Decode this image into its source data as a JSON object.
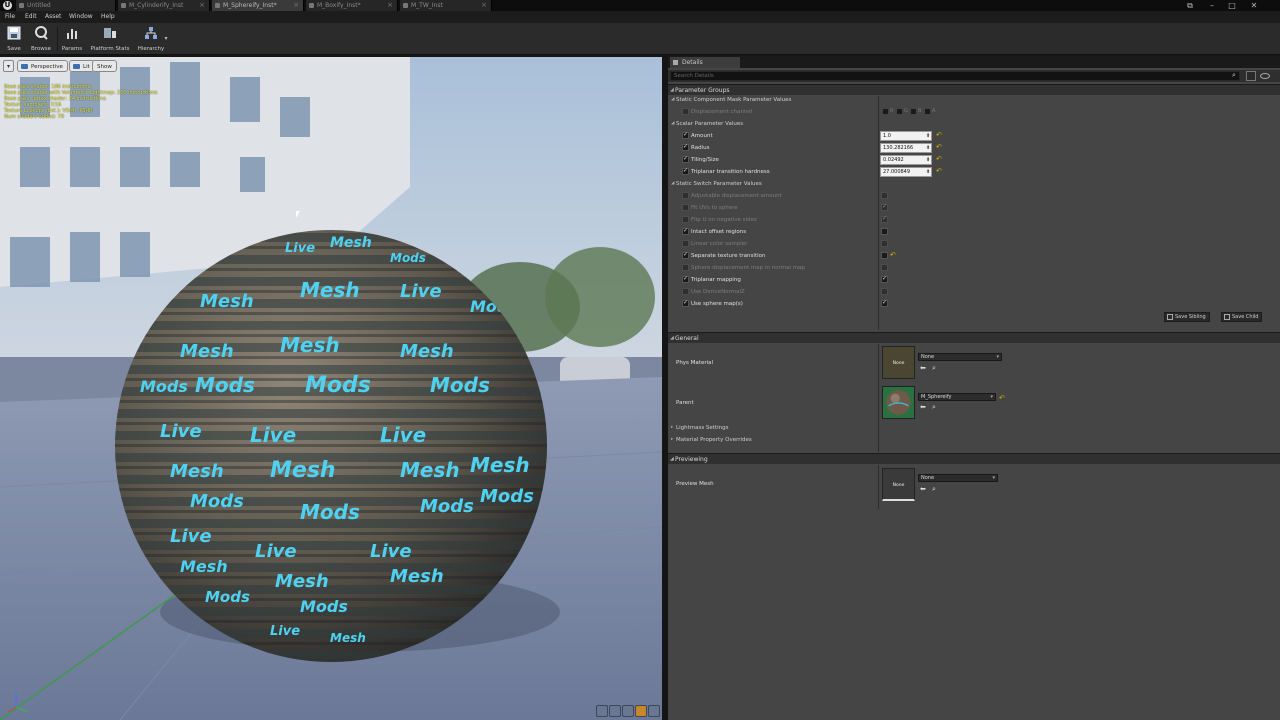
{
  "window": {
    "logo": "U",
    "tabs": [
      {
        "label": "Untitled",
        "active": false
      },
      {
        "label": "M_Cylinderify_Inst",
        "active": false
      },
      {
        "label": "M_Sphereify_Inst*",
        "active": true
      },
      {
        "label": "M_Boxify_Inst*",
        "active": false
      },
      {
        "label": "M_TW_Inst",
        "active": false
      }
    ],
    "controls": {
      "restore": "⧉",
      "minimize": "–",
      "maximize": "□",
      "close": "✕"
    }
  },
  "menu": [
    "File",
    "Edit",
    "Asset",
    "Window",
    "Help"
  ],
  "toolbar": {
    "save": "Save",
    "browse": "Browse",
    "params": "Params",
    "platform_stats": "Platform Stats",
    "hierarchy": "Hierarchy"
  },
  "viewport": {
    "dropdown": "▾",
    "perspective": "Perspective",
    "lit": "Lit",
    "show": "Show",
    "stats": [
      "Base pass shader: 186 instructions",
      "Base pass shader with Volumetric Lightmap: 256 instructions",
      "Base pass vertex shader: 34 instructions",
      "Texture samplers: 7/16",
      "Texture Lookups (Est.): VS(4), PS(8)",
      "Num shaders added: 70"
    ],
    "sphere_words": [
      "Live",
      "Mesh",
      "Mods"
    ]
  },
  "details": {
    "tab": "Details",
    "search_placeholder": "Search Details",
    "parameter_groups": "Parameter Groups",
    "static_mask_group": "Static Component Mask Parameter Values",
    "displacement_channel": "Displacement channel",
    "mask_channels": [
      "R",
      "G",
      "B",
      "A"
    ],
    "scalar_group": "Scalar Parameter Values",
    "scalars": [
      {
        "label": "Amount",
        "value": "1.0"
      },
      {
        "label": "Radius",
        "value": "130.282166"
      },
      {
        "label": "Tiling/Size",
        "value": "0.02492"
      },
      {
        "label": "Triplanar transition hardness",
        "value": "27.000849"
      }
    ],
    "switch_group": "Static Switch Parameter Values",
    "switches": [
      {
        "label": "Adjustable displacement amount",
        "enabled": false,
        "value": false
      },
      {
        "label": "Fit UVs to sphere",
        "enabled": false,
        "value": true
      },
      {
        "label": "Flip U on negative sides",
        "enabled": false,
        "value": true
      },
      {
        "label": "Intact offset regions",
        "enabled": true,
        "value": false
      },
      {
        "label": "Linear color sampler",
        "enabled": false,
        "value": false
      },
      {
        "label": "Separate texture transition",
        "enabled": true,
        "value": false
      },
      {
        "label": "Sphere displacement map in normal map",
        "enabled": false,
        "value": false
      },
      {
        "label": "Triplanar mapping",
        "enabled": true,
        "value": true
      },
      {
        "label": "Use DeriveNormalZ",
        "enabled": false,
        "value": false
      },
      {
        "label": "Use sphere map(s)",
        "enabled": true,
        "value": true
      }
    ],
    "save_sibling": "Save Sibling",
    "save_child": "Save Child",
    "general": "General",
    "phys_material": "Phys Material",
    "phys_material_value": "None",
    "thumb_none": "None",
    "parent": "Parent",
    "parent_value": "M_Sphereify",
    "lightmass": "Lightmass Settings",
    "overrides": "Material Property Overrides",
    "previewing": "Previewing",
    "preview_mesh": "Preview Mesh",
    "preview_mesh_value": "None"
  }
}
